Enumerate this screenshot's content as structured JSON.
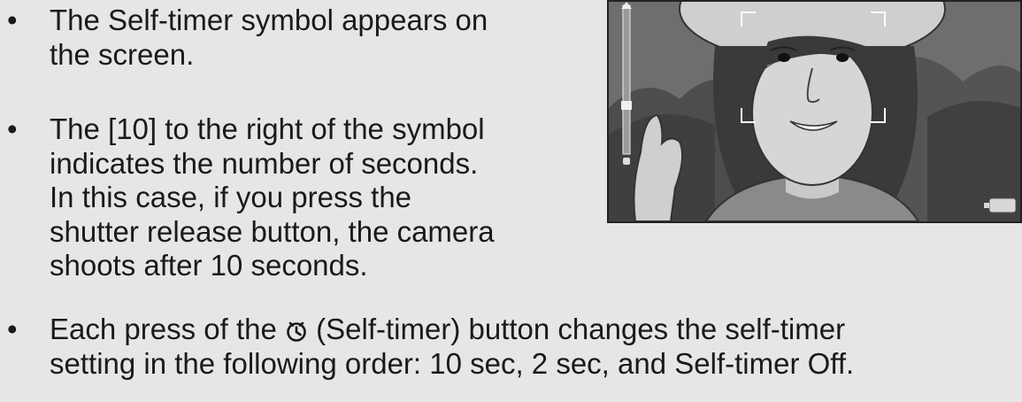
{
  "bullet_symbol": "•",
  "bullets": [
    {
      "lines": [
        "The Self-timer symbol appears on",
        "the screen."
      ]
    },
    {
      "lines": [
        "The [10] to the right of the symbol",
        "indicates the number of seconds.",
        "In this case, if you press the",
        "shutter release button, the camera",
        "shoots after 10 seconds."
      ]
    },
    {
      "before_symbol": "Each press of the",
      "symbol_icon": "self-timer-icon",
      "after_symbol": "(Self-timer) button changes the self-timer",
      "line2": "setting in the following order: 10 sec, 2 sec, and Self-timer Off."
    }
  ],
  "screen_image": {
    "icon": "camera-lcd-preview"
  }
}
